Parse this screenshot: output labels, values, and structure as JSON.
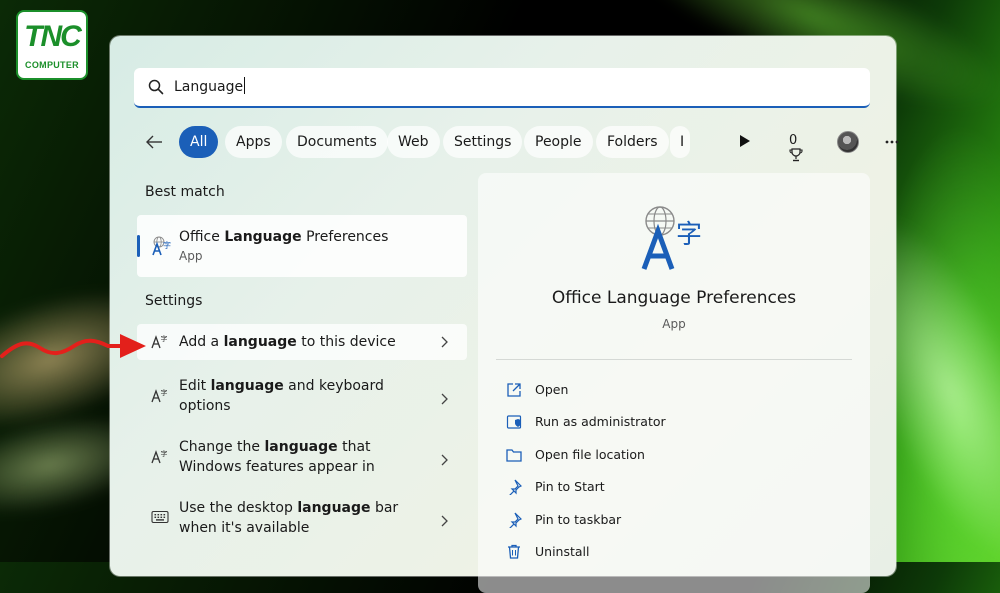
{
  "logo": {
    "brand": "TNC",
    "sub": "COMPUTER"
  },
  "search": {
    "value": "Language"
  },
  "filters": {
    "chips": [
      "All",
      "Apps",
      "Documents",
      "Web",
      "Settings",
      "People",
      "Folders",
      "I"
    ],
    "reward_count": "0"
  },
  "best_match": {
    "heading": "Best match",
    "title_pre": "Office ",
    "title_bold": "Language",
    "title_post": " Preferences",
    "sub": "App"
  },
  "settings": {
    "heading": "Settings",
    "items": [
      {
        "pre": "Add a ",
        "bold": "language",
        "post": " to this device",
        "line2": ""
      },
      {
        "pre": "Edit ",
        "bold": "language",
        "post": " and keyboard",
        "line2": "options"
      },
      {
        "pre": "Change the ",
        "bold": "language",
        "post": " that",
        "line2": "Windows features appear in"
      },
      {
        "pre": "Use the desktop ",
        "bold": "language",
        "post": " bar",
        "line2": "when it's available"
      }
    ]
  },
  "detail": {
    "title": "Office Language Preferences",
    "sub": "App",
    "actions": [
      "Open",
      "Run as administrator",
      "Open file location",
      "Pin to Start",
      "Pin to taskbar",
      "Uninstall"
    ]
  },
  "colors": {
    "accent": "#1b5fb8",
    "annotation": "#e3201b",
    "brand": "#1b8f2a"
  },
  "icons": {
    "search": "search-icon",
    "back": "back-arrow-icon",
    "play": "play-icon",
    "trophy": "trophy-icon",
    "more": "more-icon",
    "language_app": "language-app-icon",
    "language_setting": "language-setting-icon",
    "keyboard": "keyboard-icon",
    "chevron": "chevron-right-icon"
  }
}
